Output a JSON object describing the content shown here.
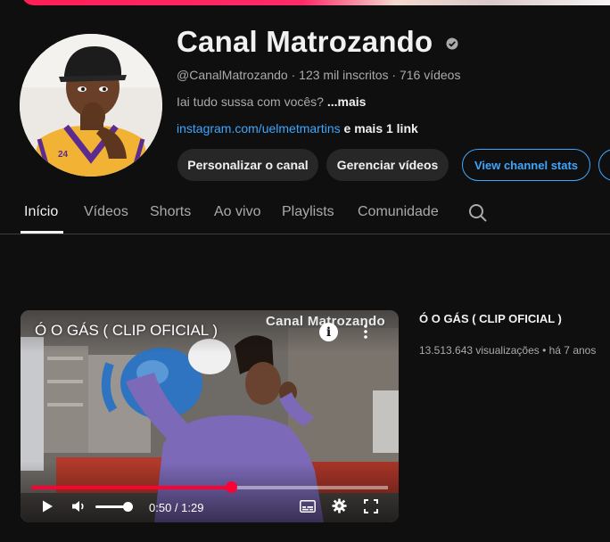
{
  "channel": {
    "name": "Canal Matrozando",
    "handle_line": "@CanalMatrozando · 123 mil inscritos · 716 vídeos",
    "description": "Iai tudo sussa com vocês?",
    "description_more": "...mais",
    "link": "instagram.com/uelmetmartins",
    "more_links": "e mais 1 link"
  },
  "buttons": {
    "customize": "Personalizar o canal",
    "manage": "Gerenciar vídeos",
    "stats": "View channel stats"
  },
  "tabs": [
    {
      "label": "Início",
      "active": true
    },
    {
      "label": "Vídeos"
    },
    {
      "label": "Shorts"
    },
    {
      "label": "Ao vivo"
    },
    {
      "label": "Playlists"
    },
    {
      "label": "Comunidade"
    }
  ],
  "featured_video": {
    "overlay_title": "Ó O GÁS ( CLIP OFICIAL )",
    "watermark": "Canal Matrozando",
    "info_icon_text": "i",
    "title": "Ó O GÁS ( CLIP OFICIAL )",
    "meta": "13.513.643 visualizações • há 7 anos",
    "time": "0:50 / 1:29",
    "progress_fraction": 0.5618,
    "volume_fraction": 1.0
  },
  "icons": {
    "verified": "verified-check-icon",
    "search": "search-icon",
    "play": "play-icon",
    "volume": "volume-icon",
    "subtitles": "subtitles-icon",
    "settings": "settings-gear-icon",
    "fullscreen": "fullscreen-icon",
    "more": "more-vert-icon",
    "info": "info-icon"
  },
  "colors": {
    "background": "#0f0f0f",
    "link_blue": "#3ea6ff",
    "progress_red": "#ff0033",
    "button_grey": "#272727"
  }
}
